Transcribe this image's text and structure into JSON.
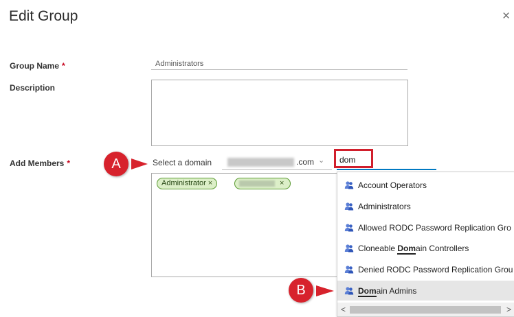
{
  "dialog": {
    "title": "Edit Group",
    "close_glyph": "×"
  },
  "form": {
    "group_name_label": "Group Name",
    "required_marker": "*",
    "group_name_value": "Administrators",
    "description_label": "Description",
    "description_value": "",
    "add_members_label": "Add Members",
    "select_domain_label": "Select a domain",
    "domain_suffix": ".com",
    "domain_chevron": "⌄",
    "search_value": "dom"
  },
  "members": {
    "chips": [
      {
        "label": "Administrator",
        "remove_glyph": "×"
      },
      {
        "label": "",
        "remove_glyph": "×"
      }
    ]
  },
  "dropdown": {
    "items": [
      {
        "prefix": "",
        "match": "",
        "suffix": "Account Operators",
        "selected": false
      },
      {
        "prefix": "",
        "match": "",
        "suffix": "Administrators",
        "selected": false
      },
      {
        "prefix": "",
        "match": "",
        "suffix": "Allowed RODC Password Replication Gro",
        "selected": false
      },
      {
        "prefix": "Cloneable ",
        "match": "Dom",
        "suffix": "ain Controllers",
        "selected": false
      },
      {
        "prefix": "",
        "match": "",
        "suffix": "Denied RODC Password Replication Grou",
        "selected": false
      },
      {
        "prefix": "",
        "match": "Dom",
        "suffix": "ain Admins",
        "selected": true
      }
    ],
    "item_icon": "group-icon",
    "scroll_left": "<",
    "scroll_right": ">"
  },
  "annotations": {
    "a_label": "A",
    "b_label": "B"
  },
  "colors": {
    "accent": "#0079c2",
    "highlight": "#d11f2c",
    "badge": "#d7222c",
    "chip_bg": "#dcefc8",
    "chip_border": "#5a9a32",
    "required": "#c6001a"
  }
}
